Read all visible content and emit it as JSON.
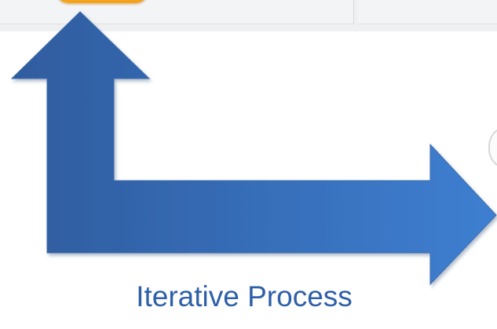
{
  "diagram": {
    "caption": "Iterative Process"
  },
  "colors": {
    "arrow_dark": "#2f5c9e",
    "arrow_light": "#3e7fd1",
    "caption_text": "#2e5fa9",
    "accent_orange": "#f5a21c",
    "panel_background": "#f3f4f5"
  },
  "icons": {
    "connector": "elbow-double-arrow-icon"
  }
}
